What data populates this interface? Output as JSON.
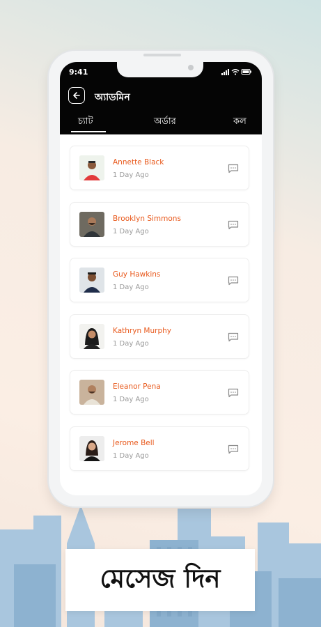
{
  "status_bar": {
    "time": "9:41"
  },
  "header": {
    "title": "অ্যাডমিন"
  },
  "tabs": [
    {
      "label": "চ্যাট",
      "active": true
    },
    {
      "label": "অর্ডার",
      "active": false
    },
    {
      "label": "কল",
      "active": false
    }
  ],
  "contacts": [
    {
      "name": "Annette Black",
      "time": "1 Day Ago"
    },
    {
      "name": "Brooklyn Simmons",
      "time": "1 Day Ago"
    },
    {
      "name": "Guy Hawkins",
      "time": "1 Day Ago"
    },
    {
      "name": "Kathryn Murphy",
      "time": "1 Day Ago"
    },
    {
      "name": "Eleanor Pena",
      "time": "1 Day Ago"
    },
    {
      "name": "Jerome Bell",
      "time": "1 Day Ago"
    }
  ],
  "banner": {
    "text": "মেসেজ দিন"
  },
  "colors": {
    "accent": "#e8591c",
    "header_bg": "#050505"
  },
  "icons": {
    "back": "arrow-left-icon",
    "message": "chat-bubble-icon"
  }
}
